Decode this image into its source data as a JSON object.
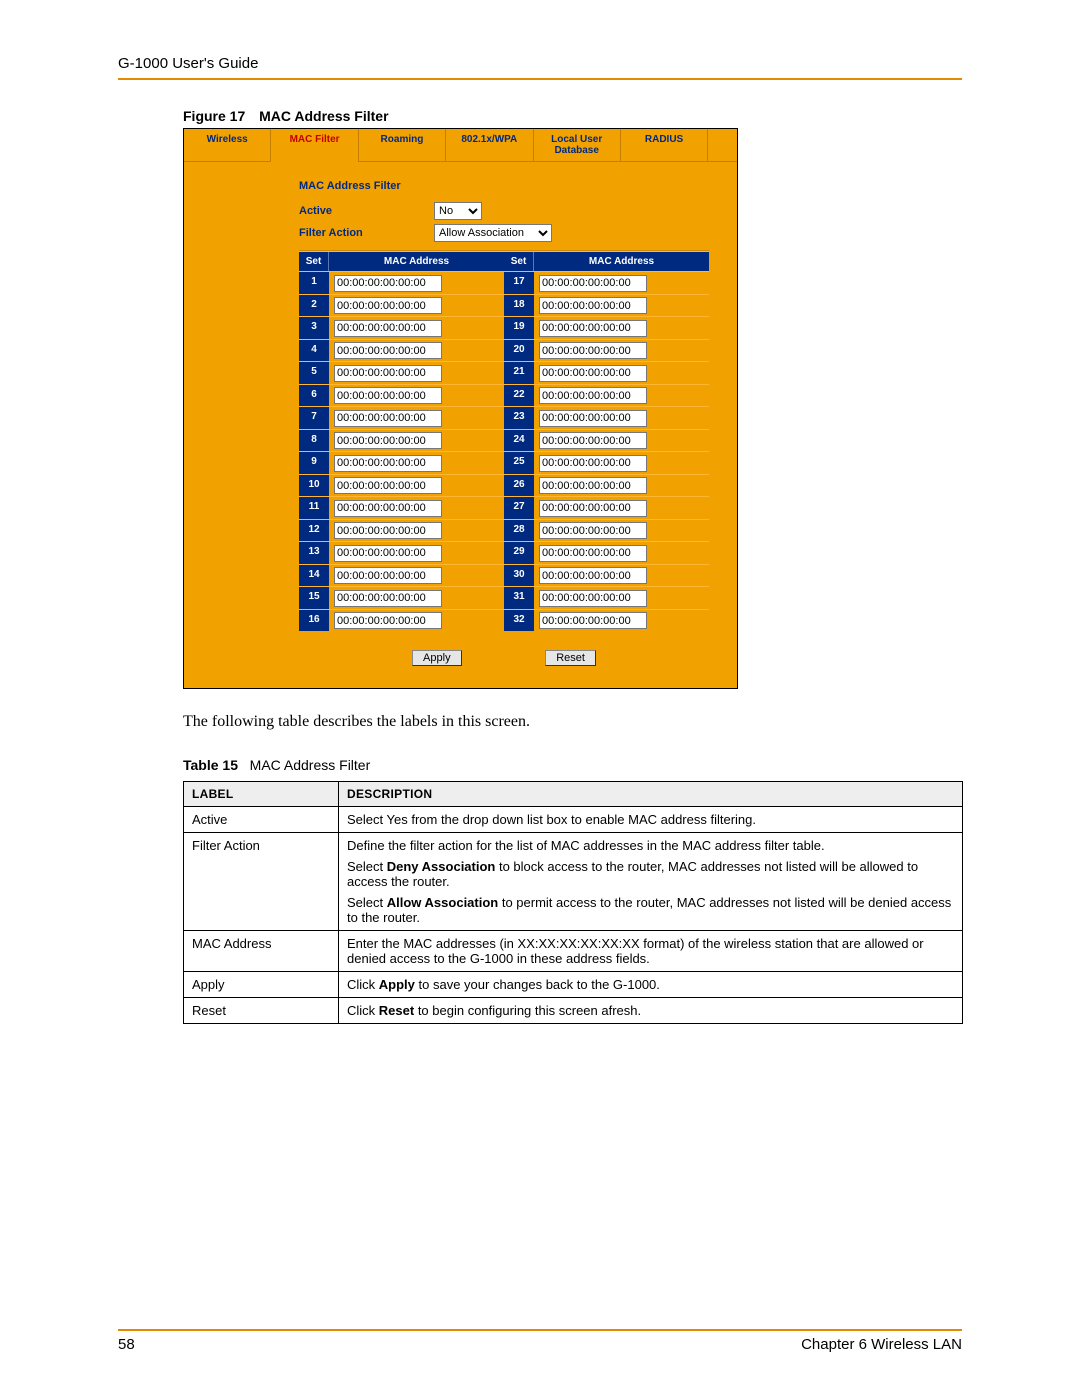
{
  "header": {
    "title": "G-1000 User's Guide"
  },
  "figure": {
    "num": "Figure 17",
    "title": "MAC Address Filter"
  },
  "config": {
    "tabs": [
      "Wireless",
      "MAC Filter",
      "Roaming",
      "802.1x/WPA",
      "Local User\nDatabase",
      "RADIUS"
    ],
    "active_tab_index": 1,
    "section_title": "MAC Address Filter",
    "active_label": "Active",
    "active_value": "No",
    "filter_action_label": "Filter Action",
    "filter_action_value": "Allow Association",
    "col_set": "Set",
    "col_addr": "MAC Address",
    "rows_left": [
      {
        "n": "1",
        "v": "00:00:00:00:00:00"
      },
      {
        "n": "2",
        "v": "00:00:00:00:00:00"
      },
      {
        "n": "3",
        "v": "00:00:00:00:00:00"
      },
      {
        "n": "4",
        "v": "00:00:00:00:00:00"
      },
      {
        "n": "5",
        "v": "00:00:00:00:00:00"
      },
      {
        "n": "6",
        "v": "00:00:00:00:00:00"
      },
      {
        "n": "7",
        "v": "00:00:00:00:00:00"
      },
      {
        "n": "8",
        "v": "00:00:00:00:00:00"
      },
      {
        "n": "9",
        "v": "00:00:00:00:00:00"
      },
      {
        "n": "10",
        "v": "00:00:00:00:00:00"
      },
      {
        "n": "11",
        "v": "00:00:00:00:00:00"
      },
      {
        "n": "12",
        "v": "00:00:00:00:00:00"
      },
      {
        "n": "13",
        "v": "00:00:00:00:00:00"
      },
      {
        "n": "14",
        "v": "00:00:00:00:00:00"
      },
      {
        "n": "15",
        "v": "00:00:00:00:00:00"
      },
      {
        "n": "16",
        "v": "00:00:00:00:00:00"
      }
    ],
    "rows_right": [
      {
        "n": "17",
        "v": "00:00:00:00:00:00"
      },
      {
        "n": "18",
        "v": "00:00:00:00:00:00"
      },
      {
        "n": "19",
        "v": "00:00:00:00:00:00"
      },
      {
        "n": "20",
        "v": "00:00:00:00:00:00"
      },
      {
        "n": "21",
        "v": "00:00:00:00:00:00"
      },
      {
        "n": "22",
        "v": "00:00:00:00:00:00"
      },
      {
        "n": "23",
        "v": "00:00:00:00:00:00"
      },
      {
        "n": "24",
        "v": "00:00:00:00:00:00"
      },
      {
        "n": "25",
        "v": "00:00:00:00:00:00"
      },
      {
        "n": "26",
        "v": "00:00:00:00:00:00"
      },
      {
        "n": "27",
        "v": "00:00:00:00:00:00"
      },
      {
        "n": "28",
        "v": "00:00:00:00:00:00"
      },
      {
        "n": "29",
        "v": "00:00:00:00:00:00"
      },
      {
        "n": "30",
        "v": "00:00:00:00:00:00"
      },
      {
        "n": "31",
        "v": "00:00:00:00:00:00"
      },
      {
        "n": "32",
        "v": "00:00:00:00:00:00"
      }
    ],
    "apply": "Apply",
    "reset": "Reset"
  },
  "paragraph": "The following table describes the labels in this screen.",
  "table_caption": {
    "num": "Table 15",
    "title": "MAC Address Filter"
  },
  "desc_table": {
    "header_label": "Label",
    "header_desc": "Description",
    "rows": [
      {
        "label": "Active",
        "desc_html": "Select Yes from the drop down list box to enable MAC address filtering."
      },
      {
        "label": "Filter Action",
        "desc_html": "<p class='desc-p'>Define the filter action for the list of MAC addresses in the MAC address filter table.</p><p class='desc-p'>Select <b>Deny Association</b> to block access to the router, MAC addresses not listed will be allowed to access the router.</p><p class='desc-p'>Select <b>Allow Association</b> to permit access to the router, MAC addresses not listed will be denied access to the router.</p>"
      },
      {
        "label": "MAC Address",
        "desc_html": "Enter the MAC addresses (in XX:XX:XX:XX:XX:XX format) of the wireless station that are allowed or denied access to the G-1000 in these address fields."
      },
      {
        "label": "Apply",
        "desc_html": "Click <b>Apply</b> to save your changes back to the G-1000."
      },
      {
        "label": "Reset",
        "desc_html": "Click <b>Reset</b> to begin configuring this screen afresh."
      }
    ]
  },
  "footer": {
    "page": "58",
    "chapter": "Chapter 6 Wireless LAN"
  }
}
